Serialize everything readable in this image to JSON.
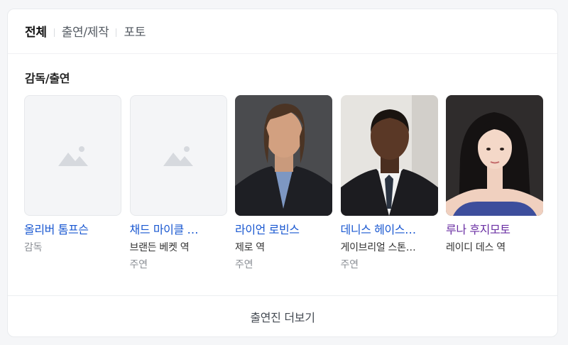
{
  "tabs": [
    {
      "label": "전체",
      "active": true
    },
    {
      "label": "출연/제작",
      "active": false
    },
    {
      "label": "포토",
      "active": false
    }
  ],
  "section_title": "감독/출연",
  "people": [
    {
      "name": "올리버 톰프슨",
      "role": "감독",
      "type": "",
      "image": "placeholder-image-icon"
    },
    {
      "name": "채드 마이클 …",
      "role": "브랜든 베켓 역",
      "type": "주연",
      "image": "placeholder-image-icon"
    },
    {
      "name": "라이언 로빈스",
      "role": "제로 역",
      "type": "주연",
      "image": "portrait-photo"
    },
    {
      "name": "데니스 헤이스…",
      "role": "게이브리얼 스톤…",
      "type": "주연",
      "image": "portrait-photo"
    },
    {
      "name": "루나 후지모토",
      "role": "레이디 데스 역",
      "type": "",
      "image": "portrait-photo"
    }
  ],
  "more_button": "출연진 더보기",
  "colors": {
    "link": "#1a58d1",
    "visited_link": "#6a2fa3",
    "muted": "#8b8f95"
  }
}
